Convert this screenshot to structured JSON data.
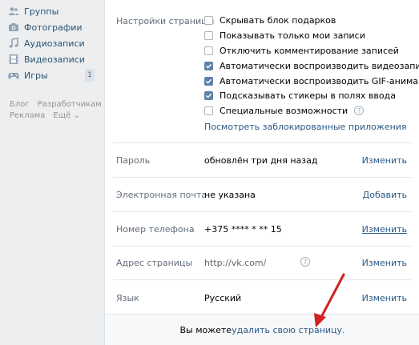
{
  "sidebar": {
    "items": [
      {
        "label": "Группы",
        "icon": "groups-icon"
      },
      {
        "label": "Фотографии",
        "icon": "camera-icon"
      },
      {
        "label": "Аудиозаписи",
        "icon": "music-note-icon"
      },
      {
        "label": "Видеозаписи",
        "icon": "film-icon"
      },
      {
        "label": "Игры",
        "icon": "gamepad-icon"
      }
    ],
    "games_badge": "1",
    "footer": {
      "blog": "Блог",
      "developers": "Разработчикам",
      "ads": "Реклама",
      "more": "Ещё ⌄"
    }
  },
  "settings": {
    "page_settings_label": "Настройки страницы",
    "checkboxes": [
      {
        "label": "Скрывать блок подарков",
        "checked": false
      },
      {
        "label": "Показывать только мои записи",
        "checked": false
      },
      {
        "label": "Отключить комментирование записей",
        "checked": false
      },
      {
        "label": "Автоматически воспроизводить видеозаписи",
        "checked": true
      },
      {
        "label": "Автоматически воспроизводить GIF-анимации",
        "checked": true
      },
      {
        "label": "Подсказывать стикеры в полях ввода",
        "checked": true
      },
      {
        "label": "Специальные возможности",
        "checked": false
      }
    ],
    "help_glyph": "?",
    "blocked_apps_link": "Посмотреть заблокированные приложения",
    "password": {
      "label": "Пароль",
      "value": "обновлён три дня назад",
      "action": "Изменить"
    },
    "email": {
      "label": "Электронная почта",
      "value": "не указана",
      "action": "Добавить"
    },
    "phone": {
      "label": "Номер телефона",
      "value": "+375 **** * ** 15",
      "action": "Изменить"
    },
    "address": {
      "label": "Адрес страницы",
      "value": "http://vk.com/",
      "action": "Изменить"
    },
    "language": {
      "label": "Язык",
      "value": "Русский",
      "action": "Изменить"
    },
    "delete_prefix": "Вы можете ",
    "delete_link": "удалить свою страницу."
  },
  "colors": {
    "link": "#2a5885",
    "checkbox_checked": "#5e81a8",
    "arrow": "#d21f1f"
  }
}
